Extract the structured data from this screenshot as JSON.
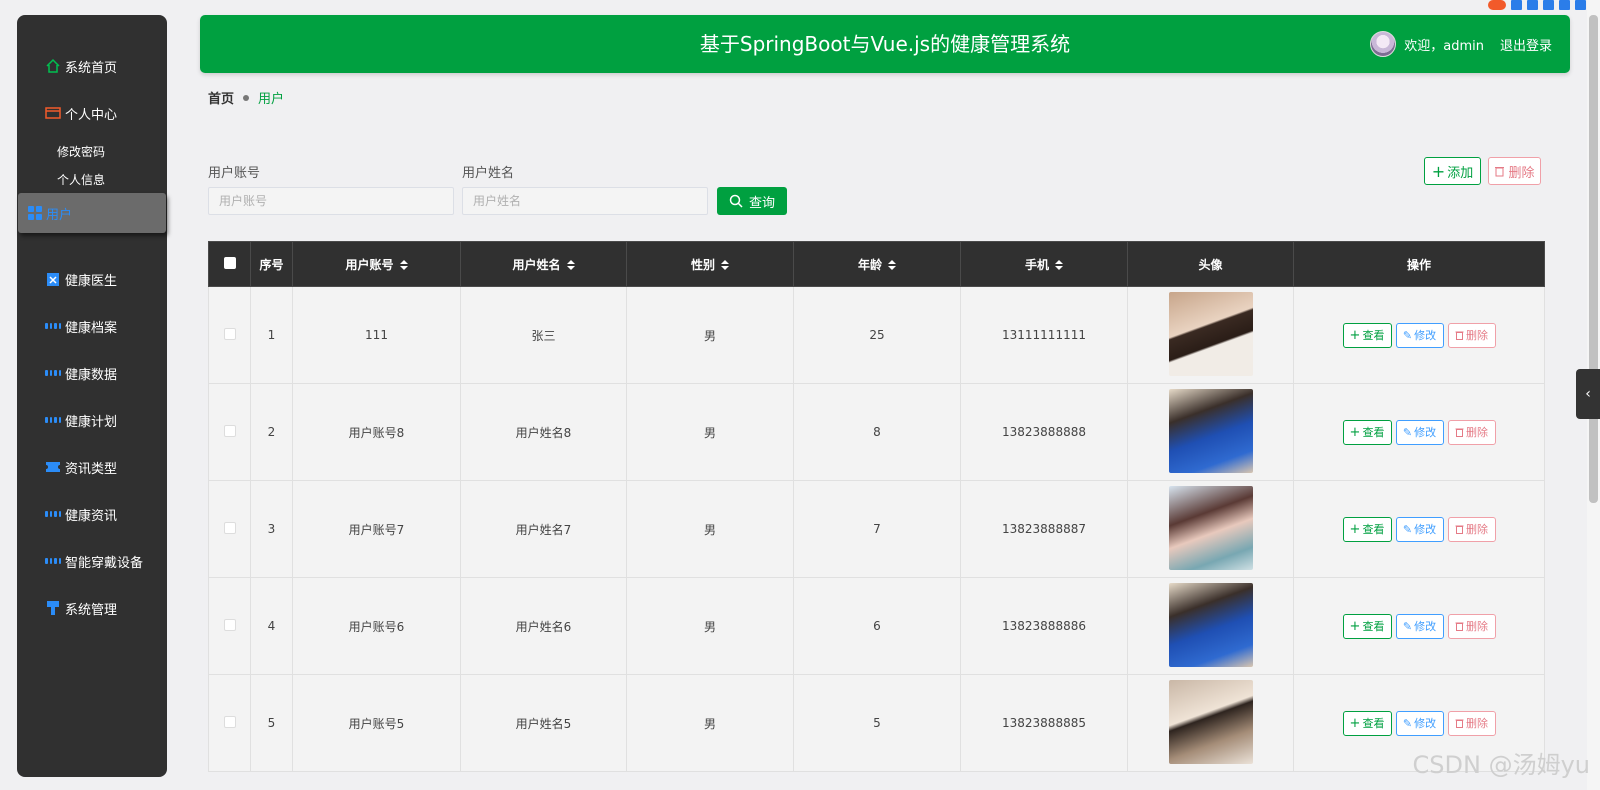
{
  "app": {
    "title": "基于SpringBoot与Vue.js的健康管理系统",
    "welcome": "欢迎，admin",
    "logout": "退出登录"
  },
  "sidebar": {
    "items": [
      {
        "label": "系统首页",
        "icon": "home-icon"
      },
      {
        "label": "个人中心",
        "icon": "id-card-icon"
      },
      {
        "label": "健康医生",
        "icon": "clipboard-icon"
      },
      {
        "label": "健康档案",
        "icon": "grid-icon"
      },
      {
        "label": "健康数据",
        "icon": "grid-icon"
      },
      {
        "label": "健康计划",
        "icon": "grid-icon"
      },
      {
        "label": "资讯类型",
        "icon": "ticket-icon"
      },
      {
        "label": "健康资讯",
        "icon": "grid-icon"
      },
      {
        "label": "智能穿戴设备",
        "icon": "grid-icon"
      },
      {
        "label": "系统管理",
        "icon": "brush-icon"
      }
    ],
    "sub": [
      "修改密码",
      "个人信息"
    ],
    "active": "用户"
  },
  "breadcrumb": {
    "home": "首页",
    "current": "用户"
  },
  "search": {
    "account_label": "用户账号",
    "account_placeholder": "用户账号",
    "name_label": "用户姓名",
    "name_placeholder": "用户姓名",
    "query": "查询"
  },
  "actions": {
    "add": "添加",
    "delete": "删除"
  },
  "table": {
    "headers": [
      "序号",
      "用户账号",
      "用户姓名",
      "性别",
      "年龄",
      "手机",
      "头像",
      "操作"
    ],
    "row_actions": {
      "view": "查看",
      "edit": "修改",
      "delete": "删除"
    },
    "rows": [
      {
        "no": "1",
        "account": "111",
        "name": "张三",
        "gender": "男",
        "age": "25",
        "phone": "13111111111"
      },
      {
        "no": "2",
        "account": "用户账号8",
        "name": "用户姓名8",
        "gender": "男",
        "age": "8",
        "phone": "13823888888"
      },
      {
        "no": "3",
        "account": "用户账号7",
        "name": "用户姓名7",
        "gender": "男",
        "age": "7",
        "phone": "13823888887"
      },
      {
        "no": "4",
        "account": "用户账号6",
        "name": "用户姓名6",
        "gender": "男",
        "age": "6",
        "phone": "13823888886"
      },
      {
        "no": "5",
        "account": "用户账号5",
        "name": "用户姓名5",
        "gender": "男",
        "age": "5",
        "phone": "13823888885"
      }
    ]
  },
  "watermark": "CSDN @汤姆yu",
  "colors": {
    "primary": "#00a040",
    "sidebar": "#303030",
    "accent": "#2b8cf7",
    "danger": "#e57a86",
    "edit": "#409eff"
  }
}
